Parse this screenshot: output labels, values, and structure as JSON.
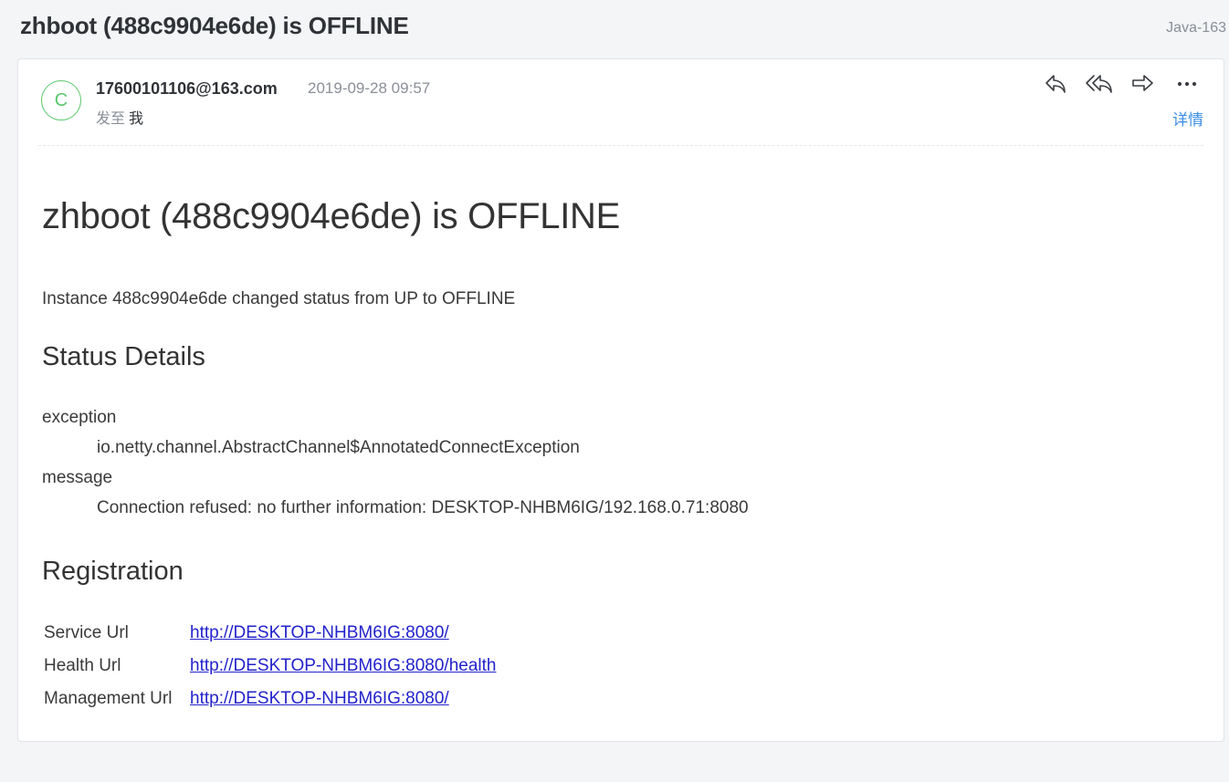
{
  "header": {
    "subject": "zhboot (488c9904e6de) is OFFLINE",
    "folder": "Java-163"
  },
  "message": {
    "avatar_letter": "C",
    "sender": "17600101106@163.com",
    "date": "2019-09-28 09:57",
    "to_prefix": "发至",
    "to_name": "我",
    "actions": {
      "reply_icon": "reply-icon",
      "reply_all_icon": "reply-all-icon",
      "forward_icon": "forward-icon",
      "more_icon": "more-icon",
      "details_label": "详情"
    }
  },
  "content": {
    "title": "zhboot (488c9904e6de) is OFFLINE",
    "intro": "Instance 488c9904e6de changed status from UP to OFFLINE",
    "status_heading": "Status Details",
    "status": [
      {
        "key": "exception",
        "value": "io.netty.channel.AbstractChannel$AnnotatedConnectException"
      },
      {
        "key": "message",
        "value": "Connection refused: no further information: DESKTOP-NHBM6IG/192.168.0.71:8080"
      }
    ],
    "registration_heading": "Registration",
    "registration": [
      {
        "label": "Service Url",
        "url": "http://DESKTOP-NHBM6IG:8080/"
      },
      {
        "label": "Health Url",
        "url": "http://DESKTOP-NHBM6IG:8080/health"
      },
      {
        "label": "Management Url",
        "url": "http://DESKTOP-NHBM6IG:8080/"
      }
    ]
  },
  "colors": {
    "avatar": "#59c96b",
    "link": "#2222cc",
    "details": "#3b8ee6"
  }
}
